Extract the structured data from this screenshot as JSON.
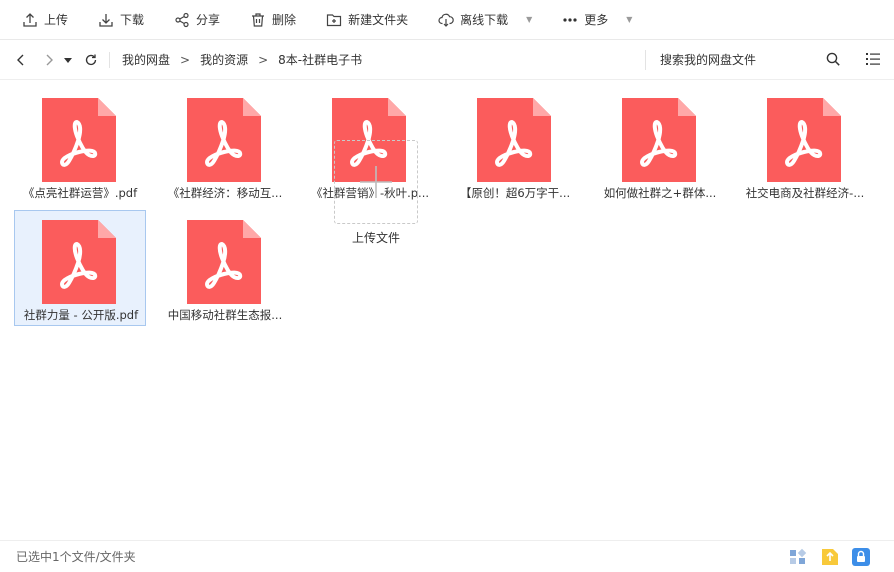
{
  "toolbar": {
    "upload": "上传",
    "download": "下载",
    "share": "分享",
    "delete": "删除",
    "new_folder": "新建文件夹",
    "offline_download": "离线下载",
    "more": "更多"
  },
  "nav": {
    "breadcrumbs": [
      "我的网盘",
      "我的资源",
      "8本-社群电子书"
    ],
    "separator": ">",
    "search_placeholder": "搜索我的网盘文件"
  },
  "files": [
    {
      "name": "《点亮社群运营》.pdf",
      "selected": false
    },
    {
      "name": "《社群经济：移动互...",
      "selected": false
    },
    {
      "name": "《社群营销》-秋叶.p...",
      "selected": false
    },
    {
      "name": "【原创！超6万字干...",
      "selected": false
    },
    {
      "name": "如何做社群之+群体...",
      "selected": false
    },
    {
      "name": "社交电商及社群经济-...",
      "selected": false
    },
    {
      "name": "社群力量 - 公开版.pdf",
      "selected": true
    },
    {
      "name": "中国移动社群生态报...",
      "selected": false
    }
  ],
  "upload_tile": {
    "label": "上传文件"
  },
  "status": {
    "text": "已选中1个文件/文件夹"
  },
  "colors": {
    "pdf": "#fb5c5c",
    "pdf_fold": "#ffa8a8",
    "selected_bg": "#e8f1fd",
    "accent": "#3d8ee8"
  }
}
